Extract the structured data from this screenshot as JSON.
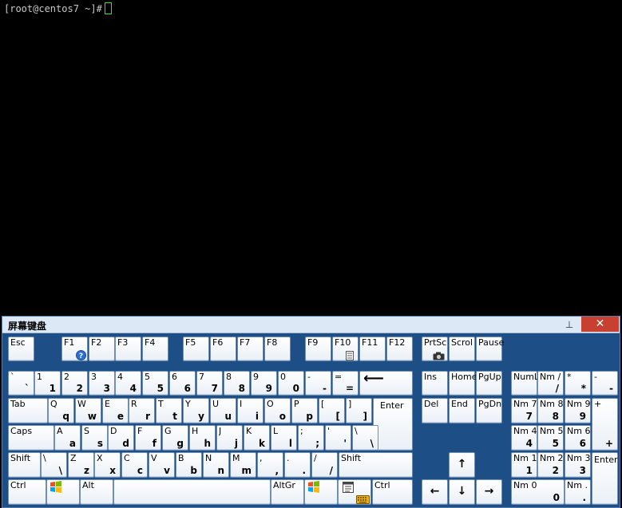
{
  "terminal": {
    "prompt": "[root@centos7 ~]#"
  },
  "osk": {
    "title": "屏幕键盘",
    "pin_symbol": "⊥",
    "close_symbol": "✕",
    "enter_arrow": "↵",
    "keys": {
      "esc": "Esc",
      "f1": "F1",
      "f2": "F2",
      "f3": "F3",
      "f4": "F4",
      "f5": "F5",
      "f6": "F6",
      "f7": "F7",
      "f8": "F8",
      "f9": "F9",
      "f10": "F10",
      "f11": "F11",
      "f12": "F12",
      "prtsc": "PrtSc",
      "scrol": "Scrol",
      "pause": "Pause",
      "backtick": [
        "`",
        "`"
      ],
      "d1": [
        "1",
        "1"
      ],
      "d2": [
        "2",
        "2"
      ],
      "d3": [
        "3",
        "3"
      ],
      "d4": [
        "4",
        "4"
      ],
      "d5": [
        "5",
        "5"
      ],
      "d6": [
        "6",
        "6"
      ],
      "d7": [
        "7",
        "7"
      ],
      "d8": [
        "8",
        "8"
      ],
      "d9": [
        "9",
        "9"
      ],
      "d0": [
        "0",
        "0"
      ],
      "minus": [
        "-",
        "-"
      ],
      "equals": [
        "=",
        "="
      ],
      "backspace": "⟵",
      "ins": "Ins",
      "home": "Home",
      "pgup": "PgUp",
      "numl": "NumL",
      "numslash": [
        "Nm /",
        "/"
      ],
      "numstar": [
        "*",
        "*"
      ],
      "numminus": [
        "-",
        "-"
      ],
      "tab": "Tab",
      "q": [
        "Q",
        "q"
      ],
      "w": [
        "W",
        "w"
      ],
      "e": [
        "E",
        "e"
      ],
      "r": [
        "R",
        "r"
      ],
      "t": [
        "T",
        "t"
      ],
      "y": [
        "Y",
        "y"
      ],
      "u": [
        "U",
        "u"
      ],
      "i": [
        "I",
        "i"
      ],
      "o": [
        "O",
        "o"
      ],
      "p": [
        "P",
        "p"
      ],
      "lbracket": [
        "[",
        "["
      ],
      "rbracket": [
        "]",
        "]"
      ],
      "enter": "Enter",
      "del": "Del",
      "end": "End",
      "pgdn": "PgDn",
      "num7": [
        "Nm 7",
        "7"
      ],
      "num8": [
        "Nm 8",
        "8"
      ],
      "num9": [
        "Nm 9",
        "9"
      ],
      "numplus": [
        "+",
        "+"
      ],
      "caps": "Caps",
      "a": [
        "A",
        "a"
      ],
      "s": [
        "S",
        "s"
      ],
      "d": [
        "D",
        "d"
      ],
      "f": [
        "F",
        "f"
      ],
      "g": [
        "G",
        "g"
      ],
      "h": [
        "H",
        "h"
      ],
      "j": [
        "J",
        "j"
      ],
      "k": [
        "K",
        "k"
      ],
      "l": [
        "L",
        "l"
      ],
      "semicolon": [
        ";",
        ";"
      ],
      "quote": [
        "'",
        "'"
      ],
      "backslash": [
        "\\",
        "\\"
      ],
      "num4": [
        "Nm 4",
        "4"
      ],
      "num5": [
        "Nm 5",
        "5"
      ],
      "num6": [
        "Nm 6",
        "6"
      ],
      "lshift": "Shift",
      "backslash2": [
        "\\",
        "\\"
      ],
      "z": [
        "Z",
        "z"
      ],
      "x": [
        "X",
        "x"
      ],
      "c": [
        "C",
        "c"
      ],
      "v": [
        "V",
        "v"
      ],
      "b": [
        "B",
        "b"
      ],
      "n": [
        "N",
        "n"
      ],
      "m": [
        "M",
        "m"
      ],
      "comma": [
        ",",
        ","
      ],
      "period": [
        ".",
        "."
      ],
      "slash": [
        "/",
        "/"
      ],
      "rshift": "Shift",
      "up": "↑",
      "num1": [
        "Nm 1",
        "1"
      ],
      "num2": [
        "Nm 2",
        "2"
      ],
      "num3": [
        "Nm 3",
        "3"
      ],
      "numenter": "Enter",
      "lctrl": "Ctrl",
      "lalt": "Alt",
      "altgr": "AltGr",
      "rctrl": "Ctrl",
      "left": "←",
      "down": "↓",
      "right": "→",
      "num0": [
        "Nm 0",
        "0"
      ],
      "numdot": [
        "Nm .",
        "."
      ]
    }
  }
}
